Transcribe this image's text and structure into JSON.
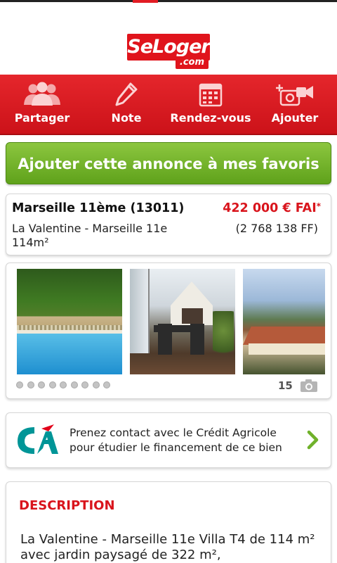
{
  "header": {
    "logo_main": "SeLoger",
    "logo_sub": ".com"
  },
  "actions": [
    {
      "label": "Partager",
      "icon": "share-users-icon"
    },
    {
      "label": "Note",
      "icon": "pencil-icon"
    },
    {
      "label": "Rendez-vous",
      "icon": "calendar-icon"
    },
    {
      "label": "Ajouter",
      "icon": "add-photo-icon"
    }
  ],
  "colors": {
    "brand_red": "#e0141c",
    "fav_green": "#6fb12a",
    "price_red": "#d9141c"
  },
  "favorite_button": "Ajouter cette annonce à mes favoris",
  "listing": {
    "city": "Marseille 11ème (13011)",
    "price": "422 000 € FAI",
    "price_marker": "*",
    "location": "La Valentine - Marseille 11e",
    "surface": "114m²",
    "price_ff": "(2 768 138 FF)"
  },
  "photos": {
    "items": [
      "pool",
      "terrace",
      "hills"
    ],
    "dots": 9,
    "count": "15"
  },
  "financing": {
    "line1": "Prenez contact avec le Crédit Agricole",
    "line2": "pour étudier le financement de ce bien"
  },
  "description": {
    "title": "DESCRIPTION",
    "text": "La Valentine - Marseille 11e Villa T4 de 114 m² avec jardin paysagé de 322 m²,"
  }
}
